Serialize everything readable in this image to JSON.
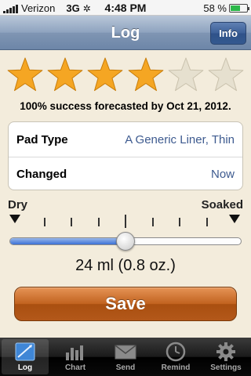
{
  "status_bar": {
    "carrier": "Verizon",
    "network": "3G",
    "time": "4:48 PM",
    "battery": "58 %",
    "battery_level": 0.58
  },
  "nav": {
    "title": "Log",
    "info_label": "Info"
  },
  "rating": {
    "filled": 4,
    "total": 6,
    "colors": {
      "filled": "#f5a623",
      "empty": "#e6e0cf"
    }
  },
  "forecast": "100% success forecasted by Oct 21, 2012.",
  "table": {
    "pad_type_label": "Pad Type",
    "pad_type_value": "A Generic Liner, Thin",
    "changed_label": "Changed",
    "changed_value": "Now"
  },
  "slider": {
    "min_label": "Dry",
    "max_label": "Soaked",
    "value_fraction": 0.5,
    "amount": "24 ml (0.8 oz.)"
  },
  "save_label": "Save",
  "tabs": [
    {
      "label": "Log",
      "icon": "log-icon",
      "selected": true
    },
    {
      "label": "Chart",
      "icon": "chart-icon"
    },
    {
      "label": "Send",
      "icon": "envelope-icon"
    },
    {
      "label": "Remind",
      "icon": "clock-icon"
    },
    {
      "label": "Settings",
      "icon": "gear-icon"
    }
  ]
}
